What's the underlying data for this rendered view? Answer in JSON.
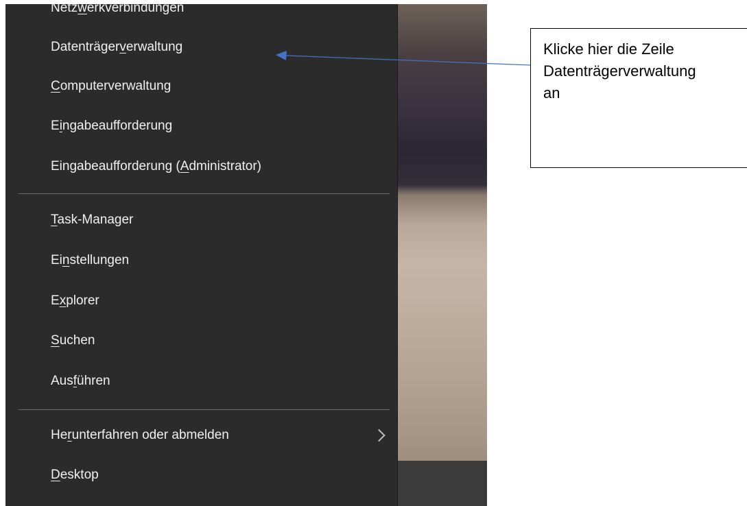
{
  "context_menu": {
    "items_group1": [
      {
        "before": "Netz",
        "u": "w",
        "after": "erkverbindungen"
      },
      {
        "before": "Datenträger",
        "u": "v",
        "after": "erwaltung"
      },
      {
        "before": "",
        "u": "C",
        "after": "omputerverwaltung"
      },
      {
        "before": "E",
        "u": "i",
        "after": "ngabeaufforderung"
      },
      {
        "before": "Eingabeaufforderung (",
        "u": "A",
        "after": "dministrator)"
      }
    ],
    "items_group2": [
      {
        "before": "",
        "u": "T",
        "after": "ask-Manager"
      },
      {
        "before": "Ei",
        "u": "n",
        "after": "stellungen"
      },
      {
        "before": "E",
        "u": "x",
        "after": "plorer"
      },
      {
        "before": "",
        "u": "S",
        "after": "uchen"
      },
      {
        "before": "Aus",
        "u": "f",
        "after": "ühren"
      }
    ],
    "items_group3": [
      {
        "before": "He",
        "u": "r",
        "after": "unterfahren oder abmelden",
        "has_submenu": true
      },
      {
        "before": "",
        "u": "D",
        "after": "esktop"
      }
    ],
    "submenu_icon": "chevron-right-icon",
    "colors": {
      "background": "#2b2b2b",
      "text": "#f0f0f0",
      "separator": "#6a6a6a"
    }
  },
  "callout": {
    "text": "Klicke hier die Zeile\nDatenträgerverwaltung\nan",
    "arrow_color": "#4472c4"
  }
}
